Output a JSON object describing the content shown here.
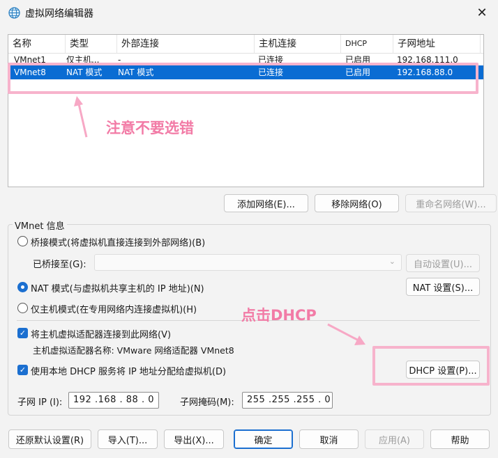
{
  "window": {
    "title": "虚拟网络编辑器",
    "close_glyph": "✕",
    "icon": "globe-network-icon"
  },
  "table": {
    "columns": [
      "名称",
      "类型",
      "外部连接",
      "主机连接",
      "DHCP",
      "子网地址"
    ],
    "rows": [
      {
        "name": "VMnet1",
        "type": "仅主机...",
        "external": "-",
        "host": "已连接",
        "dhcp": "已启用",
        "subnet": "192.168.111.0"
      },
      {
        "name": "VMnet8",
        "type": "NAT 模式",
        "external": "NAT 模式",
        "host": "已连接",
        "dhcp": "已启用",
        "subnet": "192.168.88.0",
        "selected": true
      }
    ]
  },
  "annotations": {
    "note_top": "注意不要选错",
    "note_dhcp": "点击DHCP",
    "color": "#f27ba6",
    "box_color": "#f7b3cc"
  },
  "network_buttons": {
    "add": "添加网络(E)...",
    "remove": "移除网络(O)",
    "rename": "重命名网络(W)..."
  },
  "vmnet_info": {
    "title": "VMnet 信息",
    "bridge_mode": "桥接模式(将虚拟机直接连接到外部网络)(B)",
    "bridged_to_label": "已桥接至(G):",
    "bridged_to_value": "",
    "auto_settings": "自动设置(U)...",
    "nat_mode": "NAT 模式(与虚拟机共享主机的 IP 地址)(N)",
    "nat_settings": "NAT 设置(S)...",
    "host_only": "仅主机模式(在专用网络内连接虚拟机)(H)",
    "connect_adapter": "将主机虚拟适配器连接到此网络(V)",
    "adapter_name": "主机虚拟适配器名称: VMware 网络适配器 VMnet8",
    "use_dhcp": "使用本地 DHCP 服务将 IP 地址分配给虚拟机(D)",
    "dhcp_settings": "DHCP 设置(P)...",
    "selected_mode": "nat",
    "connect_adapter_checked": true,
    "use_dhcp_checked": true
  },
  "subnet": {
    "ip_label": "子网 IP (I):",
    "ip_value": "192 .168 . 88 . 0",
    "mask_label": "子网掩码(M):",
    "mask_value": "255 .255 .255 . 0"
  },
  "footer": {
    "restore": "还原默认设置(R)",
    "import": "导入(T)...",
    "export": "导出(X)...",
    "ok": "确定",
    "cancel": "取消",
    "apply": "应用(A)",
    "help": "帮助"
  },
  "colors": {
    "selection": "#0a6cd3",
    "accent": "#1b6fd0"
  }
}
